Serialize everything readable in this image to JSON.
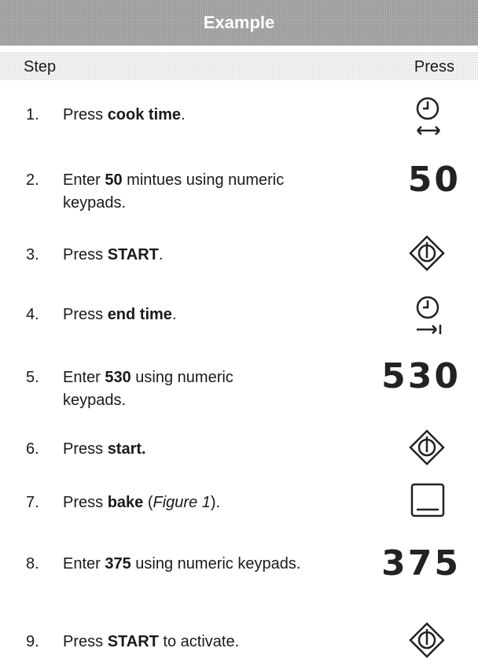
{
  "title": "Example",
  "columns": {
    "step": "Step",
    "press": "Press"
  },
  "steps": [
    {
      "num": "1.",
      "parts": [
        {
          "t": "Press "
        },
        {
          "t": "cook time",
          "b": true
        },
        {
          "t": "."
        }
      ],
      "icon": "cook-time-icon"
    },
    {
      "num": "2.",
      "parts": [
        {
          "t": "Enter "
        },
        {
          "t": "50",
          "b": true
        },
        {
          "t": " mintues using numeric keypads."
        }
      ],
      "value": "50"
    },
    {
      "num": "3.",
      "parts": [
        {
          "t": "Press "
        },
        {
          "t": "START",
          "b": true
        },
        {
          "t": "."
        }
      ],
      "icon": "start-icon"
    },
    {
      "num": "4.",
      "parts": [
        {
          "t": "Press "
        },
        {
          "t": "end time",
          "b": true
        },
        {
          "t": "."
        }
      ],
      "icon": "end-time-icon"
    },
    {
      "num": "5.",
      "parts": [
        {
          "t": "Enter "
        },
        {
          "t": "530",
          "b": true
        },
        {
          "t": " using numeric keypads."
        }
      ],
      "value": "530"
    },
    {
      "num": "6.",
      "parts": [
        {
          "t": "Press "
        },
        {
          "t": "start.",
          "b": true
        }
      ],
      "icon": "start-icon"
    },
    {
      "num": "7.",
      "parts": [
        {
          "t": "Press "
        },
        {
          "t": "bake",
          "b": true
        },
        {
          "t": " ("
        },
        {
          "t": "Figure 1",
          "i": true
        },
        {
          "t": ")."
        }
      ],
      "icon": "bake-icon"
    },
    {
      "num": "8.",
      "parts": [
        {
          "t": "Enter "
        },
        {
          "t": "375",
          "b": true
        },
        {
          "t": " using numeric keypads."
        }
      ],
      "value": "375"
    },
    {
      "num": "9.",
      "parts": [
        {
          "t": "Press "
        },
        {
          "t": "START",
          "b": true
        },
        {
          "t": " to activate."
        }
      ],
      "icon": "start-icon"
    }
  ]
}
